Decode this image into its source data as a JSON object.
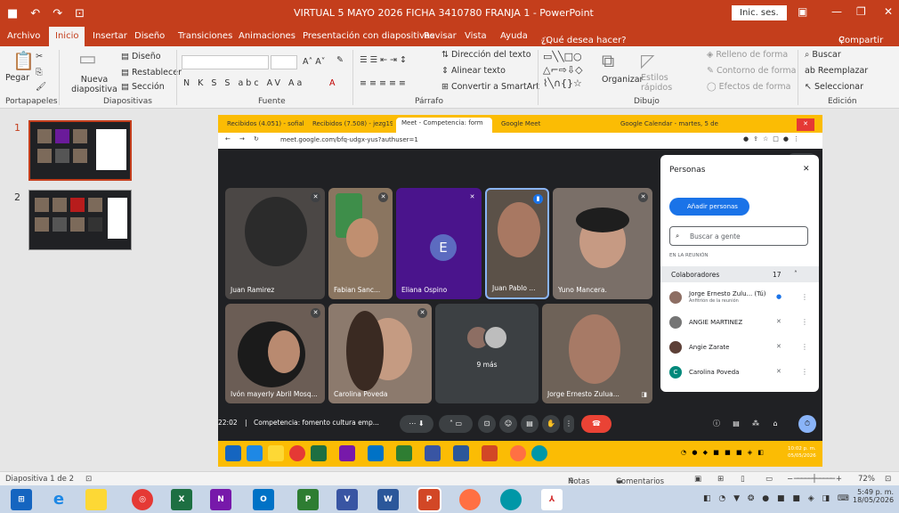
{
  "window": {
    "title": "VIRTUAL 5 MAYO 2026 FICHA 3410780 FRANJA 1  -  PowerPoint",
    "signin": "Inic. ses."
  },
  "ribbon_tabs": [
    "Archivo",
    "Inicio",
    "Insertar",
    "Diseño",
    "Transiciones",
    "Animaciones",
    "Presentación con diapositivas",
    "Revisar",
    "Vista",
    "Ayuda",
    "¿Qué desea hacer?",
    "Compartir"
  ],
  "ribbon": {
    "paste": "Pegar",
    "new_slide": "Nueva diapositiva",
    "layout": "Diseño",
    "reset": "Restablecer",
    "section": "Sección",
    "text_direction": "Dirección del texto",
    "align_text": "Alinear texto",
    "smartart": "Convertir a SmartArt",
    "arrange": "Organizar",
    "quick_styles": "Estilos rápidos",
    "shape_fill": "Relleno de forma",
    "shape_outline": "Contorno de forma",
    "shape_effects": "Efectos de forma",
    "find": "Buscar",
    "replace": "Reemplazar",
    "select": "Seleccionar",
    "groups": [
      "Portapapeles",
      "Diapositivas",
      "Fuente",
      "Párrafo",
      "Dibujo",
      "Edición"
    ]
  },
  "thumbnails": [
    "1",
    "2"
  ],
  "browser": {
    "tabs": [
      "Recibidos (4.051) - sofiakillacla",
      "Recibidos (7.508) - jezg1971@",
      "Meet - Competencia: form",
      "Google Meet",
      "Google Calendar - martes, 5 de"
    ],
    "url": "meet.google.com/bfq-udgx-yus?authuser=1",
    "participant_count": "17"
  },
  "meet": {
    "tiles": [
      "Juan Ramirez",
      "Fabian Sanc...",
      "Eliana Ospino",
      "Juan Pablo ...",
      "Yuno Mancera.",
      "Ivón mayerly Abril Mosq...",
      "Carolina Poveda",
      "9 más",
      "Jorge Ernesto Zulua..."
    ],
    "avatar_letter": "E",
    "time": "22:02",
    "meeting_title": "Competencia: fomento cultura emp...",
    "people_panel": {
      "title": "Personas",
      "add_people": "Añadir personas",
      "search_placeholder": "Buscar a gente",
      "in_meeting": "EN LA REUNIÓN",
      "collaborators": "Colaboradores",
      "collab_count": "17",
      "participants": [
        {
          "name": "Jorge Ernesto Zulu... (Tú)",
          "sub": "Anfitrión de la reunión"
        },
        {
          "name": "ANGIE MARTINEZ",
          "sub": ""
        },
        {
          "name": "Angie Zarate",
          "sub": ""
        },
        {
          "name": "Carolina Poveda",
          "sub": ""
        }
      ]
    }
  },
  "mini_clock": {
    "time": "10:02 p. m.",
    "date": "05/05/2026"
  },
  "statusbar": {
    "slide": "Diapositiva 1 de 2",
    "notes": "Notas",
    "comments": "Comentarios",
    "zoom": "72%"
  },
  "clock": {
    "time": "5:49 p. m.",
    "date": "18/05/2026"
  }
}
